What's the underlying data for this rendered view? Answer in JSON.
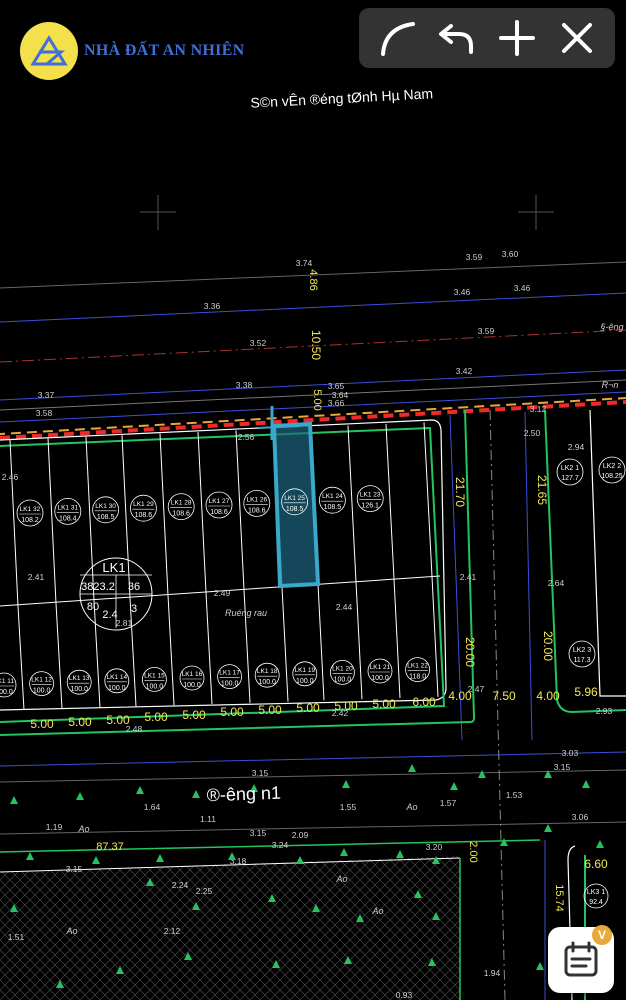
{
  "brand": {
    "name": "NHÀ ĐẤT AN NHIÊN",
    "logo_icon": "an-nhien-logo-icon"
  },
  "map": {
    "header_label": "S©n vÊn ®éng tØnh Hµ Nam",
    "street_label": "®-êng n1",
    "dims": {
      "d_486": "4.86",
      "d_1050": "10.50",
      "d_500v": "5.00",
      "d_2170": "21.70",
      "d_2165": "21.65",
      "d_2000a": "20.00",
      "d_2000b": "20.00",
      "d_200": "2.00",
      "d_1574": "15.74",
      "d_8737": "87.37",
      "d_400a": "4.00",
      "d_750": "7.50",
      "d_400b": "4.00",
      "d_596": "5.96",
      "d_600": "6.00",
      "d_660": "6.60",
      "w1": "5.00",
      "w2": "5.00",
      "w3": "5.00",
      "w4": "5.00",
      "w5": "5.00",
      "w6": "5.00",
      "w7": "5.00",
      "w8": "5.00",
      "w9": "5.00",
      "w10": "5.00"
    },
    "elev": {
      "e374": "3.74",
      "e359a": "3.59",
      "e360": "3.60",
      "e346a": "3.46",
      "e346b": "3.46",
      "e336": "3.36",
      "e352": "3.52",
      "e359b": "3.59",
      "e342": "3.42",
      "e337a": "3.37",
      "e338": "3.38",
      "e365": "3.65",
      "e364": "3.64",
      "e366": "3.66",
      "e358": "3.58",
      "e256": "2.56",
      "e250": "2.50",
      "e294": "2.94",
      "e312": "3.12",
      "e246": "2.46",
      "e241a": "2.41",
      "e241b": "2.41",
      "e249": "2.49",
      "e244": "2.44",
      "e264": "2.64",
      "e281": "2.81",
      "e247": "2.47",
      "e242": "2.42",
      "e248": "2.48",
      "e293": "2.93",
      "e303": "3.03",
      "e315a": "3.15",
      "e315b": "3.15",
      "e164": "1.64",
      "e155": "1.55",
      "e157": "1.57",
      "e153": "1.53",
      "e119": "1.19",
      "e111": "1.11",
      "e209": "2.09",
      "e324": "3.24",
      "e320": "3.20",
      "e306": "3.06",
      "e318": "3.18",
      "e224": "2.24",
      "e225": "2.25",
      "e151": "1.51",
      "e212": "2.12",
      "e194": "1.94",
      "e093": "0.93",
      "e315c": "3.15",
      "e315d": "3.15"
    },
    "text": {
      "ao1": "Ao",
      "ao2": "Ao",
      "ao3": "Ao",
      "ao4": "Ao",
      "ao5": "Ao",
      "ruong": "Ruéng rau",
      "road_r": "R¬n",
      "road_s": "§-êng"
    },
    "lk_block": {
      "name": "LK1",
      "area": "3823.2",
      "count": "36",
      "floors": "80",
      "k": "2.4",
      "h": "3"
    },
    "lots_top": [
      {
        "id": "LK1 32",
        "area": "108.2"
      },
      {
        "id": "LK1 31",
        "area": "108.4"
      },
      {
        "id": "LK1 30",
        "area": "108.5"
      },
      {
        "id": "LK1 29",
        "area": "108.6"
      },
      {
        "id": "LK1 28",
        "area": "108.6"
      },
      {
        "id": "LK1 27",
        "area": "108.6"
      },
      {
        "id": "LK1 26",
        "area": "108.6"
      },
      {
        "id": "LK1 25",
        "area": "108.5"
      },
      {
        "id": "LK1 24",
        "area": "108.5"
      },
      {
        "id": "LK1 23",
        "area": "126.1"
      }
    ],
    "lots_bottom": [
      {
        "id": "LK1 11",
        "area": "100.0"
      },
      {
        "id": "LK1 12",
        "area": "100.0"
      },
      {
        "id": "LK1 13",
        "area": "100.0"
      },
      {
        "id": "LK1 14",
        "area": "100.0"
      },
      {
        "id": "LK1 15",
        "area": "100.0"
      },
      {
        "id": "LK1 16",
        "area": "100.0"
      },
      {
        "id": "LK1 17",
        "area": "100.0"
      },
      {
        "id": "LK1 18",
        "area": "100.0"
      },
      {
        "id": "LK1 19",
        "area": "100.0"
      },
      {
        "id": "LK1 20",
        "area": "100.0"
      },
      {
        "id": "LK1 21",
        "area": "100.0"
      },
      {
        "id": "LK1 22",
        "area": "118.0"
      }
    ],
    "lots_right": [
      {
        "id": "LK2 1",
        "area": "127.7"
      },
      {
        "id": "LK2 2",
        "area": "108.25"
      },
      {
        "id": "LK2 3",
        "area": "117.3"
      },
      {
        "id": "LK3 1",
        "area": "92.4"
      }
    ]
  },
  "toolbar": {
    "curve_icon": "curve-tool-icon",
    "undo_icon": "undo-icon",
    "add_icon": "plus-icon",
    "close_icon": "close-icon"
  },
  "fab": {
    "icon": "calendar-list-icon",
    "badge": "V"
  },
  "colors": {
    "lot_line": "#ffffff",
    "green_line": "#22c55e",
    "red_dash": "#ef2a2a",
    "dim_yellow": "#f2e94e",
    "blue_line": "#3b82f6",
    "highlight": "#3aa8c8"
  }
}
